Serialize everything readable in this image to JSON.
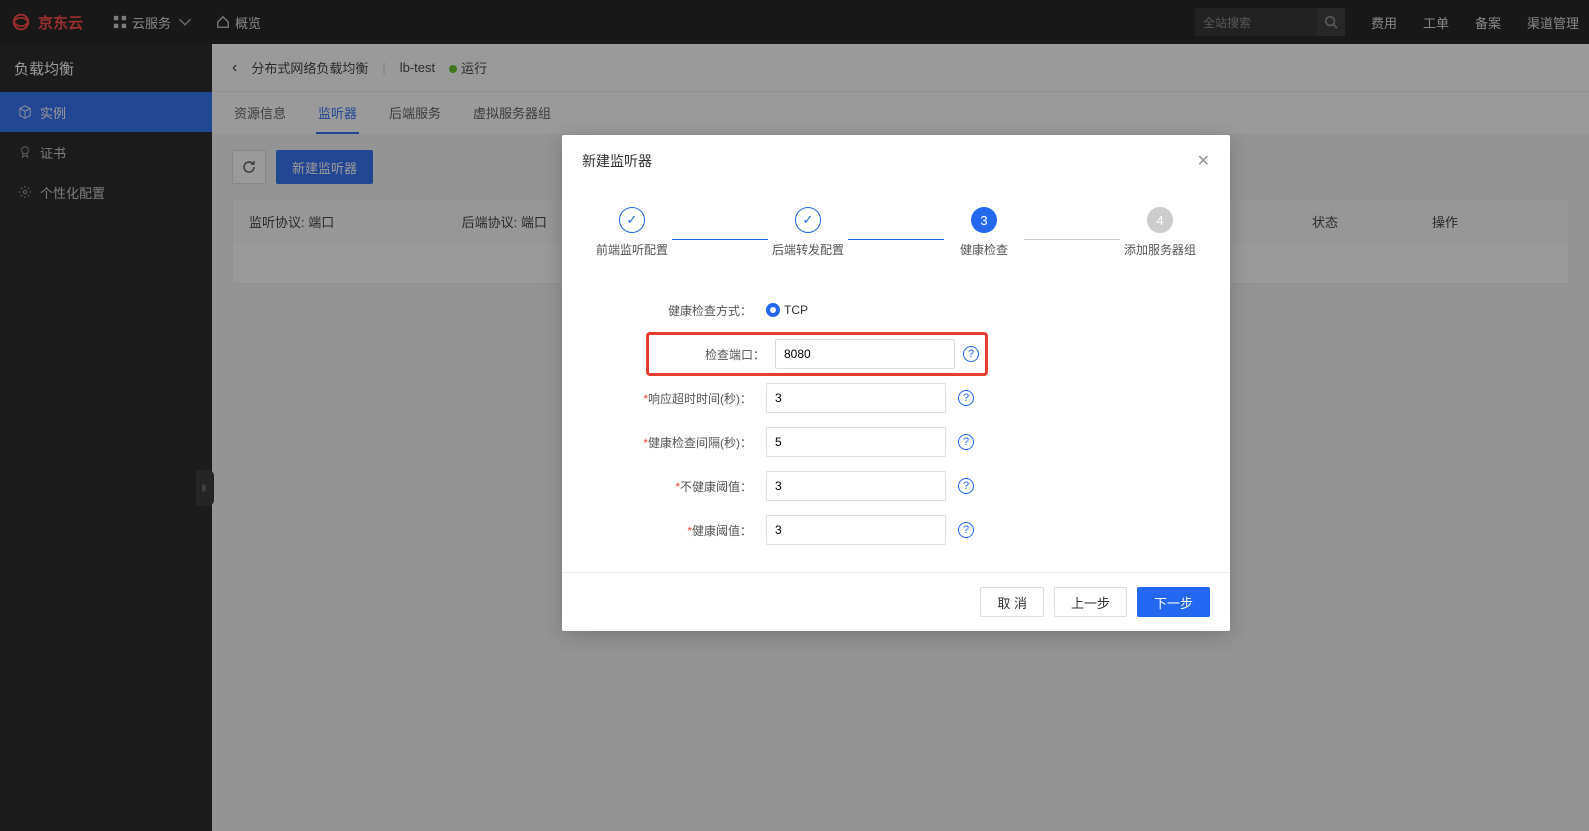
{
  "header": {
    "brand": "京东云",
    "menu_services": "云服务",
    "menu_overview": "概览",
    "search_placeholder": "全站搜索",
    "links": {
      "fee": "费用",
      "ticket": "工单",
      "record": "备案",
      "channel": "渠道管理"
    }
  },
  "sidebar": {
    "title": "负载均衡",
    "items": [
      {
        "icon": "cube",
        "label": "实例"
      },
      {
        "icon": "cert",
        "label": "证书"
      },
      {
        "icon": "gear",
        "label": "个性化配置"
      }
    ]
  },
  "breadcrumb": {
    "back_aria": "返回",
    "page": "分布式网络负载均衡",
    "resource": "lb-test",
    "status": "运行"
  },
  "tabs": [
    {
      "label": "资源信息"
    },
    {
      "label": "监听器",
      "active": true
    },
    {
      "label": "后端服务"
    },
    {
      "label": "虚拟服务器组"
    }
  ],
  "toolbar": {
    "create": "新建监听器"
  },
  "table": {
    "columns": [
      "监听协议: 端口",
      "后端协议: 端口",
      "",
      "",
      "",
      "状态",
      "操作"
    ]
  },
  "modal": {
    "title": "新建监听器",
    "steps": [
      {
        "label": "前端监听配置",
        "state": "done"
      },
      {
        "label": "后端转发配置",
        "state": "done"
      },
      {
        "label": "健康检查",
        "state": "current",
        "num": "3"
      },
      {
        "label": "添加服务器组",
        "state": "future",
        "num": "4"
      }
    ],
    "form": {
      "health_method_label": "健康检查方式：",
      "health_method_value": "TCP",
      "check_port_label": "检查端口：",
      "check_port_value": "8080",
      "timeout_label": "响应超时时间(秒)：",
      "timeout_value": "3",
      "interval_label": "健康检查间隔(秒)：",
      "interval_value": "5",
      "unhealthy_label": "不健康阈值：",
      "unhealthy_value": "3",
      "healthy_label": "健康阈值：",
      "healthy_value": "3"
    },
    "buttons": {
      "cancel": "取 消",
      "prev": "上一步",
      "next": "下一步"
    }
  }
}
